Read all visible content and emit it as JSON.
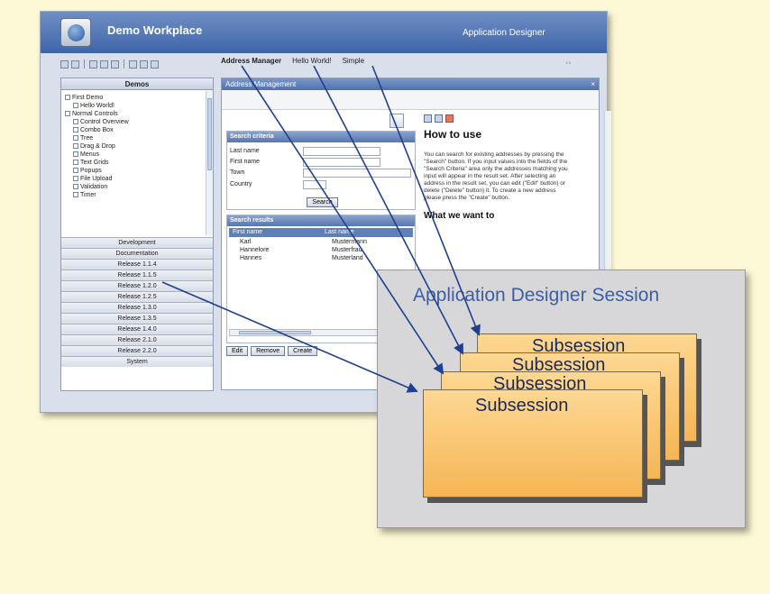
{
  "app": {
    "title": "Demo Workplace",
    "designer_label": "Application Designer",
    "tabs": [
      "Address Manager",
      "Hello World!",
      "Simple"
    ]
  },
  "nav": {
    "title": "Demos",
    "tree": [
      {
        "label": "First Demo",
        "level": 0
      },
      {
        "label": "Hello World!",
        "level": 1
      },
      {
        "label": "Normal Controls",
        "level": 0
      },
      {
        "label": "Control Overview",
        "level": 1
      },
      {
        "label": "Combo Box",
        "level": 1
      },
      {
        "label": "Tree",
        "level": 1
      },
      {
        "label": "Drag & Drop",
        "level": 1
      },
      {
        "label": "Menus",
        "level": 1
      },
      {
        "label": "Text Grids",
        "level": 1
      },
      {
        "label": "Popups",
        "level": 1
      },
      {
        "label": "File Upload",
        "level": 1
      },
      {
        "label": "Validation",
        "level": 1
      },
      {
        "label": "Timer",
        "level": 1
      }
    ],
    "sections": [
      "Development",
      "Documentation",
      "Release 1.1.4",
      "Release 1.1.5",
      "Release 1.2.0",
      "Release 1.2.5",
      "Release 1.3.0",
      "Release 1.3.5",
      "Release 1.4.0",
      "Release 2.1.0",
      "Release 2.2.0",
      "System"
    ]
  },
  "address_manager": {
    "title": "Address Management",
    "search_criteria": {
      "title": "Search criteria",
      "fields": [
        "Last name",
        "First name",
        "Town",
        "Country"
      ],
      "search_label": "Search"
    },
    "search_results": {
      "title": "Search results",
      "columns": [
        "First name",
        "Last name"
      ],
      "rows": [
        [
          "Karl",
          "Mustermann"
        ],
        [
          "Hannelore",
          "Musterfrau"
        ],
        [
          "Hannes",
          "Musterland"
        ]
      ],
      "buttons": [
        "Edit",
        "Remove",
        "Create"
      ]
    },
    "help": {
      "title": "How to use",
      "body": "You can search for existing addresses by pressing the \"Search\" button. If you input values into the fields of the \"Search Criteria\" area only the addresses matching you input will appear in the result set. After selecting an address in the result set, you can edit (\"Edit\" button) or delete (\"Delete\" button) it. To create a new address please press the \"Create\" button.",
      "subtitle": "What we want to"
    }
  },
  "diagram": {
    "session_label": "Application Designer Session",
    "subsession_label": "Subsession"
  },
  "colors": {
    "background": "#fdf8d6",
    "session_box": "#d7d7da",
    "subsession_fill": "#f8c268",
    "session_text": "#3a5fa8",
    "arrow": "#1f3f8f"
  }
}
